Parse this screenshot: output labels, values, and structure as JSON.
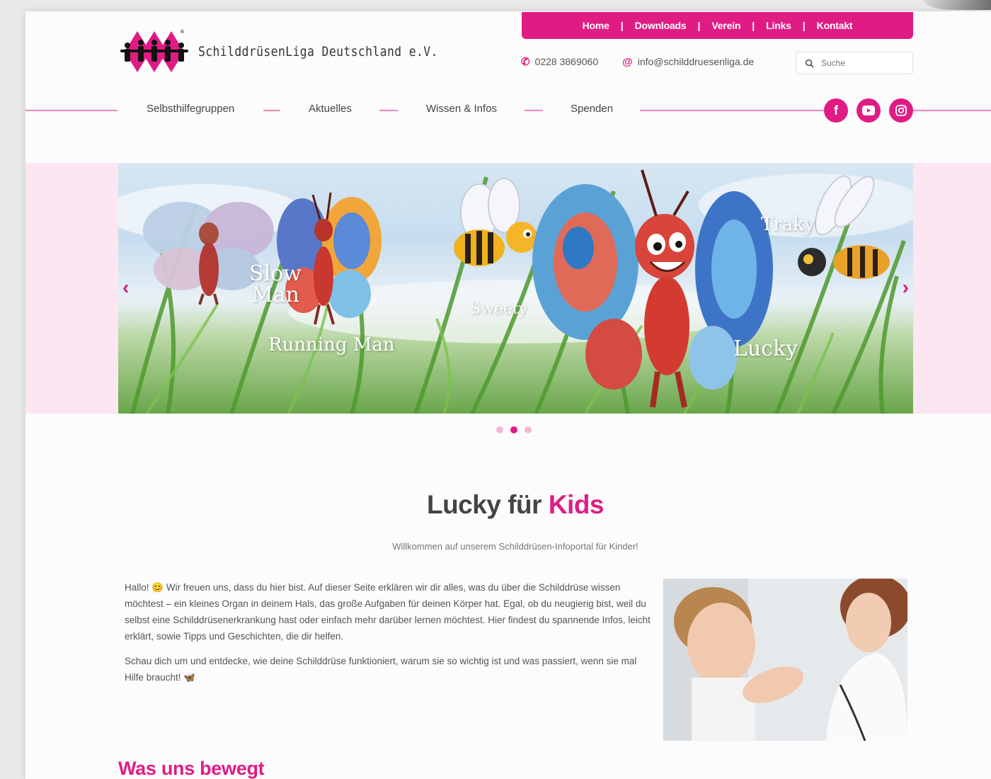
{
  "brand": {
    "name": "SchilddrüsenLiga Deutschland e.V.",
    "accent": "#e01c84",
    "light_accent": "#fbe6f1"
  },
  "top_menu": [
    "Home",
    "Downloads",
    "Verein",
    "Links",
    "Kontakt"
  ],
  "contact": {
    "phone": "0228 3869060",
    "email": "info@schilddruesenliga.de"
  },
  "search": {
    "placeholder": "Suche"
  },
  "nav": [
    "Selbsthilfegruppen",
    "Aktuelles",
    "Wissen & Infos",
    "Spenden"
  ],
  "social": [
    "facebook-icon",
    "youtube-icon",
    "instagram-icon"
  ],
  "hero": {
    "captions": [
      "Slow Man",
      "Running Man",
      "Sweety",
      "Traky",
      "Lucky"
    ],
    "slides": 3,
    "active_slide": 2
  },
  "content": {
    "title_main": "Lucky für ",
    "title_highlight": "Kids",
    "subtitle": "Willkommen auf unserem Schilddrüsen-Infoportal für Kinder!",
    "paragraph1": "Hallo! 😊 Wir freuen uns, dass du hier bist. Auf dieser Seite erklären wir dir alles, was du über die Schilddrüse wissen möchtest – ein kleines Organ in deinem Hals, das große Aufgaben für deinen Körper hat. Egal, ob du neugierig bist, weil du selbst eine Schilddrüsenerkrankung hast oder einfach mehr darüber lernen möchtest. Hier findest du spannende Infos, leicht erklärt, sowie Tipps und Geschichten, die dir helfen.",
    "paragraph2": "Schau dich um und entdecke, wie deine Schilddrüse funktioniert, warum sie so wichtig ist und was passiert, wenn sie mal Hilfe braucht! 🦋",
    "section_title": "Was uns bewegt"
  }
}
